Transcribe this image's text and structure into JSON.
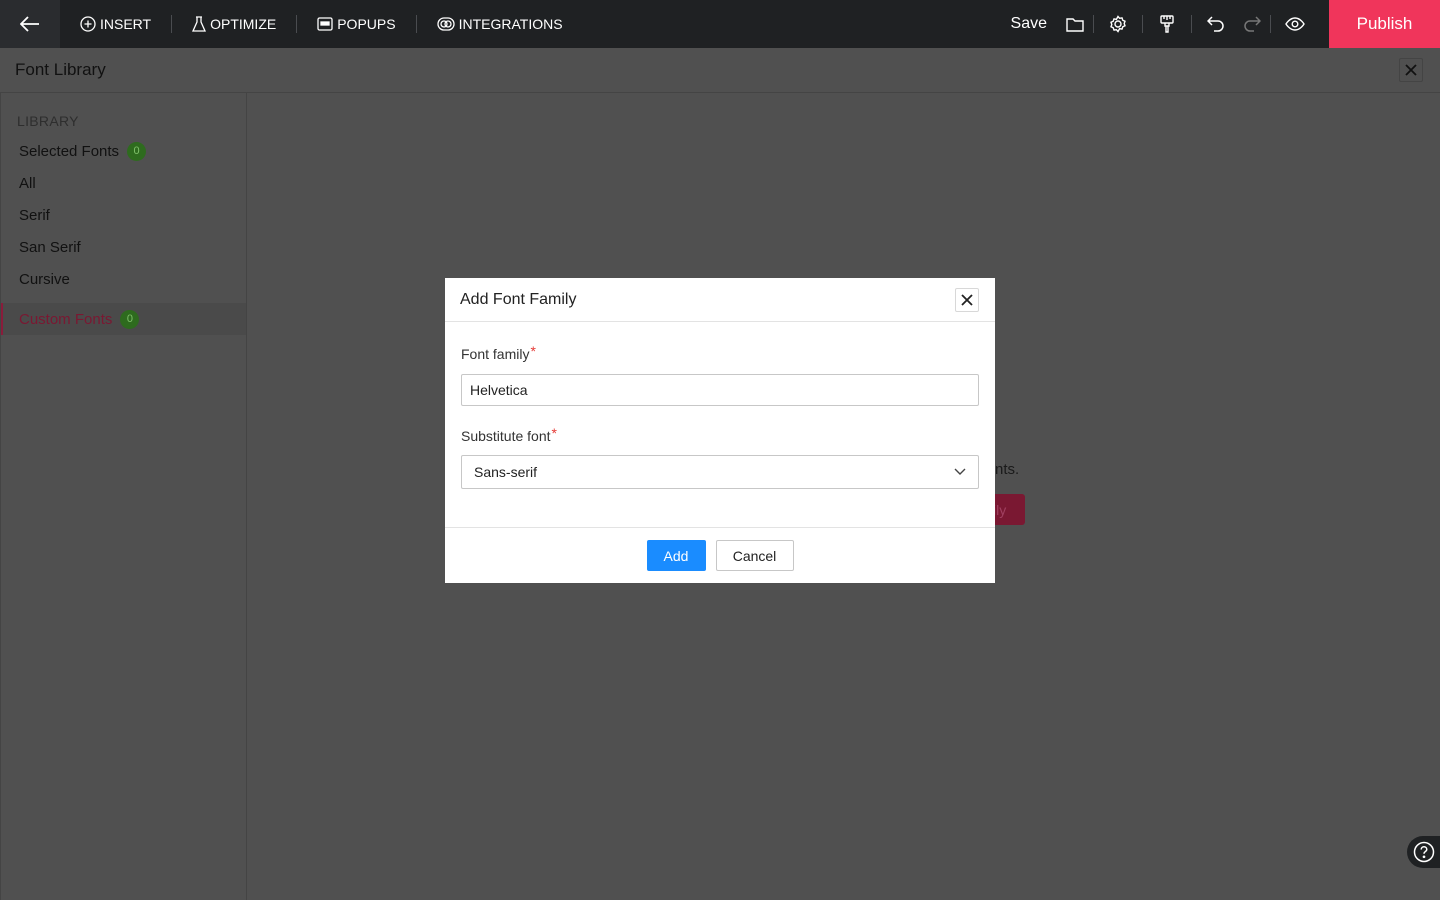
{
  "topbar": {
    "back_icon": "arrow-left-icon",
    "menu": [
      {
        "label": "INSERT",
        "icon": "plus-circle-icon"
      },
      {
        "label": "OPTIMIZE",
        "icon": "flask-icon"
      },
      {
        "label": "POPUPS",
        "icon": "popup-icon"
      },
      {
        "label": "INTEGRATIONS",
        "icon": "integrations-icon"
      }
    ],
    "save_label": "Save",
    "publish_label": "Publish",
    "publish_color": "#f0355b"
  },
  "library": {
    "title": "Font Library",
    "section_label": "LIBRARY",
    "items": [
      {
        "label": "Selected Fonts",
        "badge": "0"
      },
      {
        "label": "All"
      },
      {
        "label": "Serif"
      },
      {
        "label": "San Serif"
      },
      {
        "label": "Cursive"
      }
    ],
    "custom": {
      "label": "Custom Fonts",
      "badge": "0"
    }
  },
  "background": {
    "text_fragment": "nts.",
    "button_fragment": "ily"
  },
  "modal": {
    "title": "Add Font Family",
    "font_family_label": "Font family",
    "font_family_value": "Helvetica",
    "substitute_label": "Substitute font",
    "substitute_value": "Sans-serif",
    "required_mark": "*",
    "add_label": "Add",
    "cancel_label": "Cancel",
    "accent_color": "#1a8cff"
  }
}
